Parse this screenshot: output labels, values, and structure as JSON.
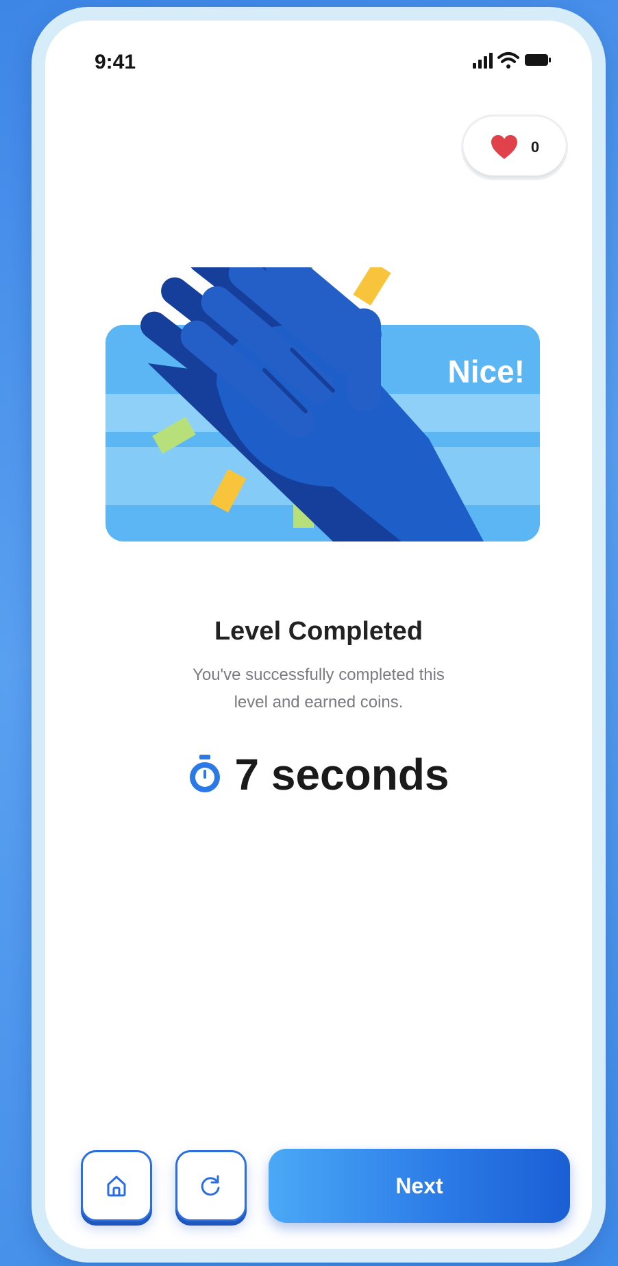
{
  "status_bar": {
    "time": "9:41"
  },
  "lives": {
    "count": "0"
  },
  "hero": {
    "banner_text": "Nice!"
  },
  "result": {
    "title": "Level Completed",
    "subtitle": "You've successfully completed this level and earned coins.",
    "time_text": "7 seconds"
  },
  "actions": {
    "next_label": "Next"
  },
  "colors": {
    "accent": "#2a79e6",
    "heart": "#e0424c",
    "banner": "#5bb6f3",
    "hand": "#1e5ec8"
  }
}
